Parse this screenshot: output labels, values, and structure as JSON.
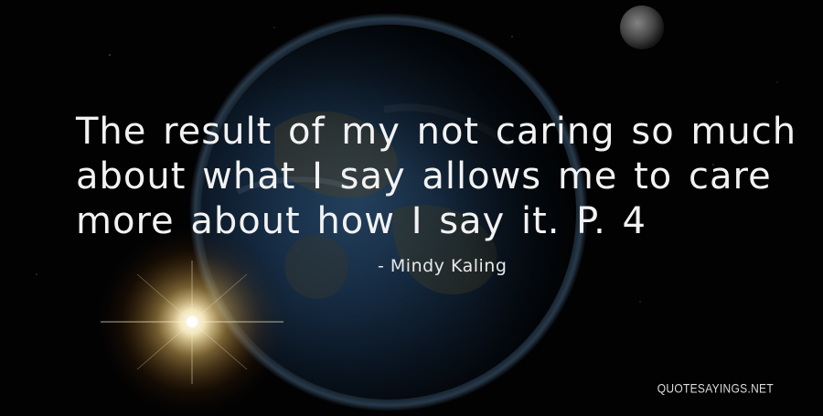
{
  "quote": {
    "lines": [
      "The result of my not caring so much",
      "about what I say allows me to care",
      "more about how I say it. P. 4"
    ]
  },
  "author": {
    "text": "- Mindy Kaling"
  },
  "watermark": {
    "text": "QUOTESAYINGS.NET"
  },
  "colors": {
    "background": "#020203",
    "text": "#f2f2f2",
    "sun_glow": "#ffd98a",
    "earth_blue": "#1c3a5c"
  },
  "icons": {
    "background": "earth-from-space-illustration",
    "moon": "moon-icon",
    "sun": "sun-flare-icon"
  }
}
